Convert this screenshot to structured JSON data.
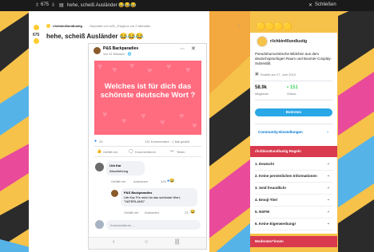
{
  "browser": {
    "counter": "675",
    "tab_title": "hehe, scheiß Ausländer 😂😂😂",
    "close_label": "Schließen"
  },
  "post": {
    "vote_count": "675",
    "subreddit": "r/ichbin40undlustig",
    "posted_by": "Gepostet von u/Dr_Papproz vor 2 Monaten",
    "title": "hehe, scheiß Ausländer 😂😂😂"
  },
  "fb": {
    "page_name": "P&S Backparadies",
    "time": "Vor 31 Minuten · 🌐",
    "image_text": "Welches ist für dich das schönste deutsche Wort ?",
    "reactions_count": "33",
    "comments_meta": "131 Kommentare · 1 Mal geteilt",
    "like_label": "Gefällt mir",
    "comment_label": "Kommentieren",
    "share_label": "Teilen",
    "comment1_author": "Urb Kar",
    "comment1_text": "Abschiebung",
    "comment1_like": "Gefällt mir",
    "comment1_reply": "Antworten",
    "comment1_count": "125",
    "reply_author": "P&S Backparadies",
    "reply_text": "Urb Kar Für mich ist das schönste Wort, \"VATERLAND\"",
    "reply_like": "Gefällt mir",
    "reply_reply": "Antworten",
    "reply_count": "23",
    "comment_placeholder": "Kommentieren …"
  },
  "sidebar": {
    "community": "r/ichbin40undlustig",
    "description": "Pseudohumoristische Bildchen aus dem deutschsprachigen Raum und Boomer-Cosplay-Subreddit.",
    "created": "Erstellt am 27. Juni 2019",
    "members_value": "58.9k",
    "members_label": "Mitglieder",
    "online_value": "• 151",
    "online_label": "Online",
    "join_label": "Beitreten",
    "settings_label": "Community-Einstellungen"
  },
  "rules": {
    "header": "r/ichbin40undlustig Regeln",
    "items": [
      "1. Deutsch!",
      "2. Keine persönlichen Informationen",
      "3. Seid freundlich!",
      "4. Emoji-Titel",
      "5. NSFW",
      "6. Keine Eigenwerbung!"
    ]
  },
  "moderators": {
    "header": "Moderator*innen"
  },
  "colors": {
    "accent_red": "#d93a4e",
    "join_blue": "#2aa7e6",
    "image_pink": "#ff6b7f"
  }
}
